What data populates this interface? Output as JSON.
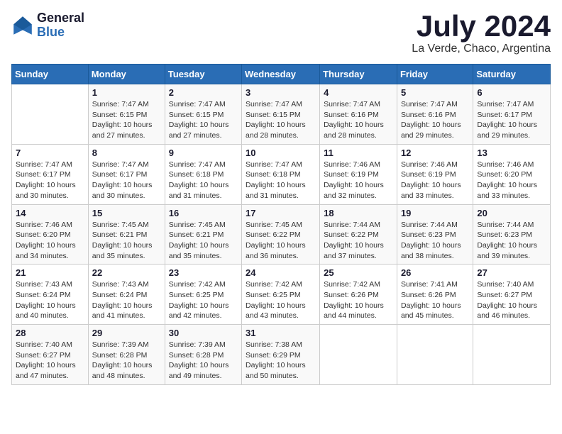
{
  "logo": {
    "line1": "General",
    "line2": "Blue"
  },
  "title": "July 2024",
  "location": "La Verde, Chaco, Argentina",
  "days_of_week": [
    "Sunday",
    "Monday",
    "Tuesday",
    "Wednesday",
    "Thursday",
    "Friday",
    "Saturday"
  ],
  "weeks": [
    [
      {
        "day": "",
        "info": ""
      },
      {
        "day": "1",
        "info": "Sunrise: 7:47 AM\nSunset: 6:15 PM\nDaylight: 10 hours and 27 minutes."
      },
      {
        "day": "2",
        "info": "Sunrise: 7:47 AM\nSunset: 6:15 PM\nDaylight: 10 hours and 27 minutes."
      },
      {
        "day": "3",
        "info": "Sunrise: 7:47 AM\nSunset: 6:15 PM\nDaylight: 10 hours and 28 minutes."
      },
      {
        "day": "4",
        "info": "Sunrise: 7:47 AM\nSunset: 6:16 PM\nDaylight: 10 hours and 28 minutes."
      },
      {
        "day": "5",
        "info": "Sunrise: 7:47 AM\nSunset: 6:16 PM\nDaylight: 10 hours and 29 minutes."
      },
      {
        "day": "6",
        "info": "Sunrise: 7:47 AM\nSunset: 6:17 PM\nDaylight: 10 hours and 29 minutes."
      }
    ],
    [
      {
        "day": "7",
        "info": "Sunrise: 7:47 AM\nSunset: 6:17 PM\nDaylight: 10 hours and 30 minutes."
      },
      {
        "day": "8",
        "info": "Sunrise: 7:47 AM\nSunset: 6:17 PM\nDaylight: 10 hours and 30 minutes."
      },
      {
        "day": "9",
        "info": "Sunrise: 7:47 AM\nSunset: 6:18 PM\nDaylight: 10 hours and 31 minutes."
      },
      {
        "day": "10",
        "info": "Sunrise: 7:47 AM\nSunset: 6:18 PM\nDaylight: 10 hours and 31 minutes."
      },
      {
        "day": "11",
        "info": "Sunrise: 7:46 AM\nSunset: 6:19 PM\nDaylight: 10 hours and 32 minutes."
      },
      {
        "day": "12",
        "info": "Sunrise: 7:46 AM\nSunset: 6:19 PM\nDaylight: 10 hours and 33 minutes."
      },
      {
        "day": "13",
        "info": "Sunrise: 7:46 AM\nSunset: 6:20 PM\nDaylight: 10 hours and 33 minutes."
      }
    ],
    [
      {
        "day": "14",
        "info": "Sunrise: 7:46 AM\nSunset: 6:20 PM\nDaylight: 10 hours and 34 minutes."
      },
      {
        "day": "15",
        "info": "Sunrise: 7:45 AM\nSunset: 6:21 PM\nDaylight: 10 hours and 35 minutes."
      },
      {
        "day": "16",
        "info": "Sunrise: 7:45 AM\nSunset: 6:21 PM\nDaylight: 10 hours and 35 minutes."
      },
      {
        "day": "17",
        "info": "Sunrise: 7:45 AM\nSunset: 6:22 PM\nDaylight: 10 hours and 36 minutes."
      },
      {
        "day": "18",
        "info": "Sunrise: 7:44 AM\nSunset: 6:22 PM\nDaylight: 10 hours and 37 minutes."
      },
      {
        "day": "19",
        "info": "Sunrise: 7:44 AM\nSunset: 6:23 PM\nDaylight: 10 hours and 38 minutes."
      },
      {
        "day": "20",
        "info": "Sunrise: 7:44 AM\nSunset: 6:23 PM\nDaylight: 10 hours and 39 minutes."
      }
    ],
    [
      {
        "day": "21",
        "info": "Sunrise: 7:43 AM\nSunset: 6:24 PM\nDaylight: 10 hours and 40 minutes."
      },
      {
        "day": "22",
        "info": "Sunrise: 7:43 AM\nSunset: 6:24 PM\nDaylight: 10 hours and 41 minutes."
      },
      {
        "day": "23",
        "info": "Sunrise: 7:42 AM\nSunset: 6:25 PM\nDaylight: 10 hours and 42 minutes."
      },
      {
        "day": "24",
        "info": "Sunrise: 7:42 AM\nSunset: 6:25 PM\nDaylight: 10 hours and 43 minutes."
      },
      {
        "day": "25",
        "info": "Sunrise: 7:42 AM\nSunset: 6:26 PM\nDaylight: 10 hours and 44 minutes."
      },
      {
        "day": "26",
        "info": "Sunrise: 7:41 AM\nSunset: 6:26 PM\nDaylight: 10 hours and 45 minutes."
      },
      {
        "day": "27",
        "info": "Sunrise: 7:40 AM\nSunset: 6:27 PM\nDaylight: 10 hours and 46 minutes."
      }
    ],
    [
      {
        "day": "28",
        "info": "Sunrise: 7:40 AM\nSunset: 6:27 PM\nDaylight: 10 hours and 47 minutes."
      },
      {
        "day": "29",
        "info": "Sunrise: 7:39 AM\nSunset: 6:28 PM\nDaylight: 10 hours and 48 minutes."
      },
      {
        "day": "30",
        "info": "Sunrise: 7:39 AM\nSunset: 6:28 PM\nDaylight: 10 hours and 49 minutes."
      },
      {
        "day": "31",
        "info": "Sunrise: 7:38 AM\nSunset: 6:29 PM\nDaylight: 10 hours and 50 minutes."
      },
      {
        "day": "",
        "info": ""
      },
      {
        "day": "",
        "info": ""
      },
      {
        "day": "",
        "info": ""
      }
    ]
  ]
}
